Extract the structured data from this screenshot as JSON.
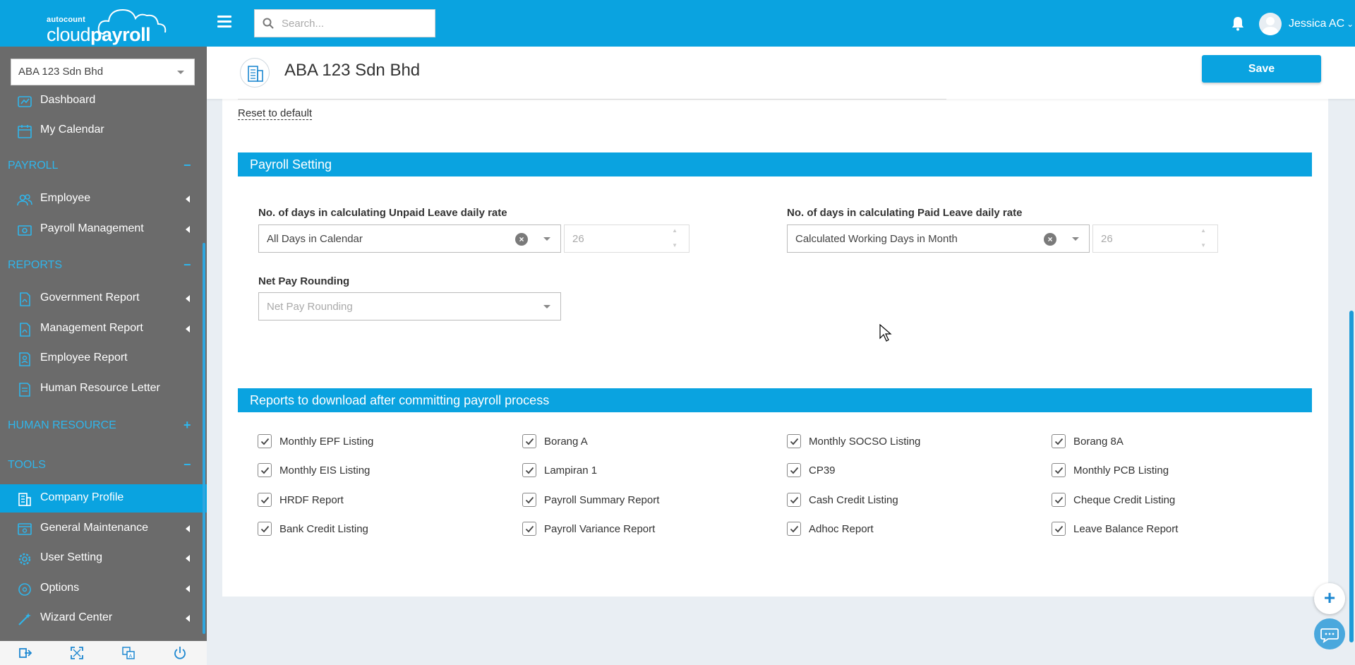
{
  "app": {
    "brand_small": "autocount",
    "brand_left": "cloud",
    "brand_right": "payroll"
  },
  "topbar": {
    "search_placeholder": "Search...",
    "user_name": "Jessica AC"
  },
  "sidebar": {
    "company": "ABA 123 Sdn Bhd",
    "items_top": [
      {
        "label": "Dashboard",
        "icon": "dashboard-icon"
      },
      {
        "label": "My Calendar",
        "icon": "calendar-icon"
      }
    ],
    "sections": {
      "payroll": {
        "label": "PAYROLL",
        "toggle": "−"
      },
      "reports": {
        "label": "REPORTS",
        "toggle": "−"
      },
      "human_resource": {
        "label": "HUMAN RESOURCE",
        "toggle": "+"
      },
      "tools": {
        "label": "TOOLS",
        "toggle": "−"
      }
    },
    "payroll_items": [
      {
        "label": "Employee"
      },
      {
        "label": "Payroll Management"
      }
    ],
    "report_items": [
      {
        "label": "Government Report"
      },
      {
        "label": "Management Report"
      },
      {
        "label": "Employee Report"
      },
      {
        "label": "Human Resource Letter"
      }
    ],
    "tool_items": [
      {
        "label": "Company Profile",
        "active": true
      },
      {
        "label": "General Maintenance"
      },
      {
        "label": "User Setting"
      },
      {
        "label": "Options"
      },
      {
        "label": "Wizard Center"
      }
    ]
  },
  "header": {
    "title": "ABA 123 Sdn Bhd",
    "save_label": "Save"
  },
  "main": {
    "reset_label": "Reset to default",
    "payroll_setting": {
      "title": "Payroll Setting",
      "unpaid_label": "No. of days in calculating Unpaid Leave daily rate",
      "unpaid_value": "All Days in Calendar",
      "unpaid_days": "26",
      "paid_label": "No. of days in calculating Paid Leave daily rate",
      "paid_value": "Calculated Working Days in Month",
      "paid_days": "26",
      "rounding_label": "Net Pay Rounding",
      "rounding_placeholder": "Net Pay Rounding"
    },
    "reports": {
      "title": "Reports to download after committing payroll process",
      "items": [
        {
          "label": "Monthly EPF Listing",
          "checked": true
        },
        {
          "label": "Borang A",
          "checked": true
        },
        {
          "label": "Monthly SOCSO Listing",
          "checked": true
        },
        {
          "label": "Borang 8A",
          "checked": true
        },
        {
          "label": "Monthly EIS Listing",
          "checked": true
        },
        {
          "label": "Lampiran 1",
          "checked": true
        },
        {
          "label": "CP39",
          "checked": true
        },
        {
          "label": "Monthly PCB Listing",
          "checked": true
        },
        {
          "label": "HRDF Report",
          "checked": true
        },
        {
          "label": "Payroll Summary Report",
          "checked": true
        },
        {
          "label": "Cash Credit Listing",
          "checked": true
        },
        {
          "label": "Cheque Credit Listing",
          "checked": true
        },
        {
          "label": "Bank Credit Listing",
          "checked": true
        },
        {
          "label": "Payroll Variance Report",
          "checked": true
        },
        {
          "label": "Adhoc Report",
          "checked": true
        },
        {
          "label": "Leave Balance Report",
          "checked": true
        }
      ]
    }
  },
  "colors": {
    "brand": "#0aa3e0",
    "sidebar": "#6b6b6b",
    "section_text": "#2fb6ec"
  }
}
